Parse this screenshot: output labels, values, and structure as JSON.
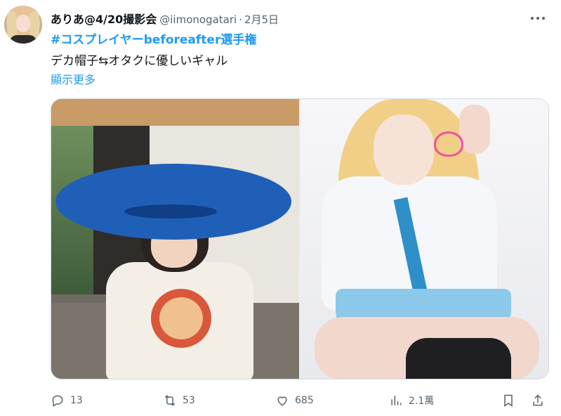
{
  "user": {
    "name": "ありあ@4/20撮影会",
    "handle": "@iimonogatari",
    "separator": "·",
    "date": "2月5日"
  },
  "tweet": {
    "hashtag": "#コスプレイヤーbeforeafter選手権",
    "text": "デカ帽子⇆オタクに優しいギャル",
    "show_more": "顯示更多"
  },
  "media": {
    "images": [
      "childhood-photo",
      "cosplay-photo"
    ]
  },
  "actions": {
    "reply": {
      "icon": "reply-icon",
      "count": "13"
    },
    "retweet": {
      "icon": "retweet-icon",
      "count": "53"
    },
    "like": {
      "icon": "heart-icon",
      "count": "685"
    },
    "views": {
      "icon": "views-icon",
      "count": "2.1萬"
    },
    "bookmark": {
      "icon": "bookmark-icon"
    },
    "share": {
      "icon": "share-icon"
    }
  },
  "colors": {
    "accent": "#1d9bf0",
    "text": "#0f1419",
    "muted": "#536471",
    "border": "#cfd9de"
  }
}
